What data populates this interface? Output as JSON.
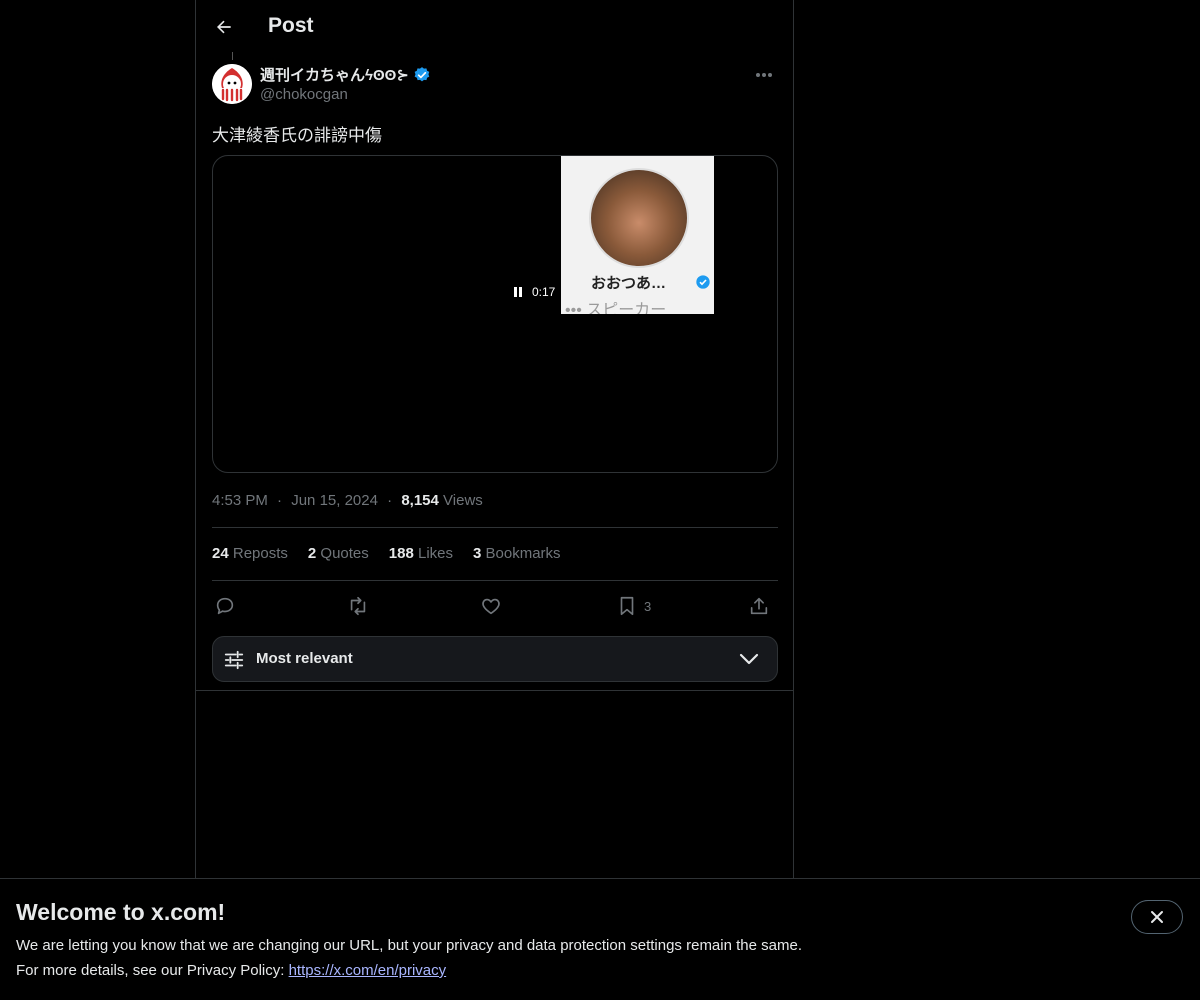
{
  "header": {
    "title": "Post"
  },
  "tweet": {
    "author_name": "週刊イカちゃんϟʘʘ⊱",
    "handle": "@chokocgan",
    "text": "大津綾香氏の誹謗中傷",
    "video": {
      "timecode": "0:17",
      "frame_name": "おおつあ…",
      "frame_sub": "••• スピーカー"
    },
    "time": "4:53 PM",
    "date": "Jun 15, 2024",
    "views_count": "8,154",
    "views_label": "Views",
    "separator": "·"
  },
  "stats": {
    "reposts_count": "24",
    "reposts_label": "Reposts",
    "quotes_count": "2",
    "quotes_label": "Quotes",
    "likes_count": "188",
    "likes_label": "Likes",
    "bookmarks_count": "3",
    "bookmarks_label": "Bookmarks"
  },
  "actions": {
    "bookmark_count": "3"
  },
  "sort": {
    "label": "Most relevant"
  },
  "banner": {
    "title": "Welcome to x.com!",
    "line1": "We are letting you know that we are changing our URL, but your privacy and data protection settings remain the same.",
    "line2_prefix": "For more details, see our Privacy Policy: ",
    "link": "https://x.com/en/privacy"
  },
  "colors": {
    "accent": "#1d9bf0",
    "background": "#000000",
    "muted": "#71767b",
    "border": "#2f3336"
  }
}
